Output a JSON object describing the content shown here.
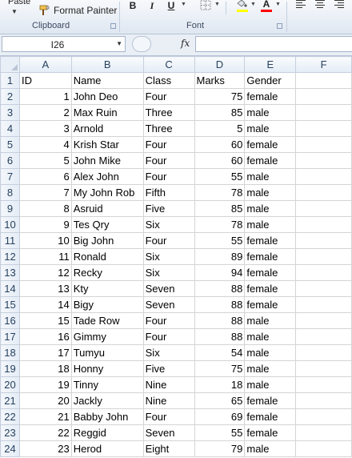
{
  "ribbon": {
    "paste_label": "Paste",
    "format_painter_label": "Format Painter",
    "clipboard_group": "Clipboard",
    "font_group": "Font",
    "bold": "B",
    "italic": "I",
    "underline": "U",
    "font_color_glyph": "A",
    "fill_color": "#ffff00",
    "font_color": "#ff0000",
    "icons": [
      "paint-brush-icon",
      "borders-icon",
      "fill-color-icon",
      "font-color-icon",
      "align-left-icon",
      "align-center-icon",
      "align-right-icon"
    ]
  },
  "formula_bar": {
    "name_box": "I26",
    "fx_label": "fx",
    "formula": ""
  },
  "sheet": {
    "columns": [
      "A",
      "B",
      "C",
      "D",
      "E",
      "F"
    ],
    "rows": [
      {
        "n": "1",
        "cells": [
          "ID",
          "Name",
          "Class",
          "Marks",
          "Gender",
          ""
        ]
      },
      {
        "n": "2",
        "cells": [
          "1",
          "John Deo",
          "Four",
          "75",
          "female",
          ""
        ]
      },
      {
        "n": "3",
        "cells": [
          "2",
          "Max Ruin",
          "Three",
          "85",
          "male",
          ""
        ]
      },
      {
        "n": "4",
        "cells": [
          "3",
          "Arnold",
          "Three",
          "5",
          "male",
          ""
        ]
      },
      {
        "n": "5",
        "cells": [
          "4",
          "Krish Star",
          "Four",
          "60",
          "female",
          ""
        ]
      },
      {
        "n": "6",
        "cells": [
          "5",
          "John Mike",
          "Four",
          "60",
          "female",
          ""
        ]
      },
      {
        "n": "7",
        "cells": [
          "6",
          "Alex John",
          "Four",
          "55",
          "male",
          ""
        ]
      },
      {
        "n": "8",
        "cells": [
          "7",
          "My John Rob",
          "Fifth",
          "78",
          "male",
          ""
        ]
      },
      {
        "n": "9",
        "cells": [
          "8",
          "Asruid",
          "Five",
          "85",
          "male",
          ""
        ]
      },
      {
        "n": "10",
        "cells": [
          "9",
          "Tes Qry",
          "Six",
          "78",
          "male",
          ""
        ]
      },
      {
        "n": "11",
        "cells": [
          "10",
          "Big John",
          "Four",
          "55",
          "female",
          ""
        ]
      },
      {
        "n": "12",
        "cells": [
          "11",
          "Ronald",
          "Six",
          "89",
          "female",
          ""
        ]
      },
      {
        "n": "13",
        "cells": [
          "12",
          "Recky",
          "Six",
          "94",
          "female",
          ""
        ]
      },
      {
        "n": "14",
        "cells": [
          "13",
          "Kty",
          "Seven",
          "88",
          "female",
          ""
        ]
      },
      {
        "n": "15",
        "cells": [
          "14",
          "Bigy",
          "Seven",
          "88",
          "female",
          ""
        ]
      },
      {
        "n": "16",
        "cells": [
          "15",
          "Tade Row",
          "Four",
          "88",
          "male",
          ""
        ]
      },
      {
        "n": "17",
        "cells": [
          "16",
          "Gimmy",
          "Four",
          "88",
          "male",
          ""
        ]
      },
      {
        "n": "18",
        "cells": [
          "17",
          "Tumyu",
          "Six",
          "54",
          "male",
          ""
        ]
      },
      {
        "n": "19",
        "cells": [
          "18",
          "Honny",
          "Five",
          "75",
          "male",
          ""
        ]
      },
      {
        "n": "20",
        "cells": [
          "19",
          "Tinny",
          "Nine",
          "18",
          "male",
          ""
        ]
      },
      {
        "n": "21",
        "cells": [
          "20",
          "Jackly",
          "Nine",
          "65",
          "female",
          ""
        ]
      },
      {
        "n": "22",
        "cells": [
          "21",
          "Babby John",
          "Four",
          "69",
          "female",
          ""
        ]
      },
      {
        "n": "23",
        "cells": [
          "22",
          "Reggid",
          "Seven",
          "55",
          "female",
          ""
        ]
      },
      {
        "n": "24",
        "cells": [
          "23",
          "Herod",
          "Eight",
          "79",
          "male",
          ""
        ]
      }
    ]
  }
}
